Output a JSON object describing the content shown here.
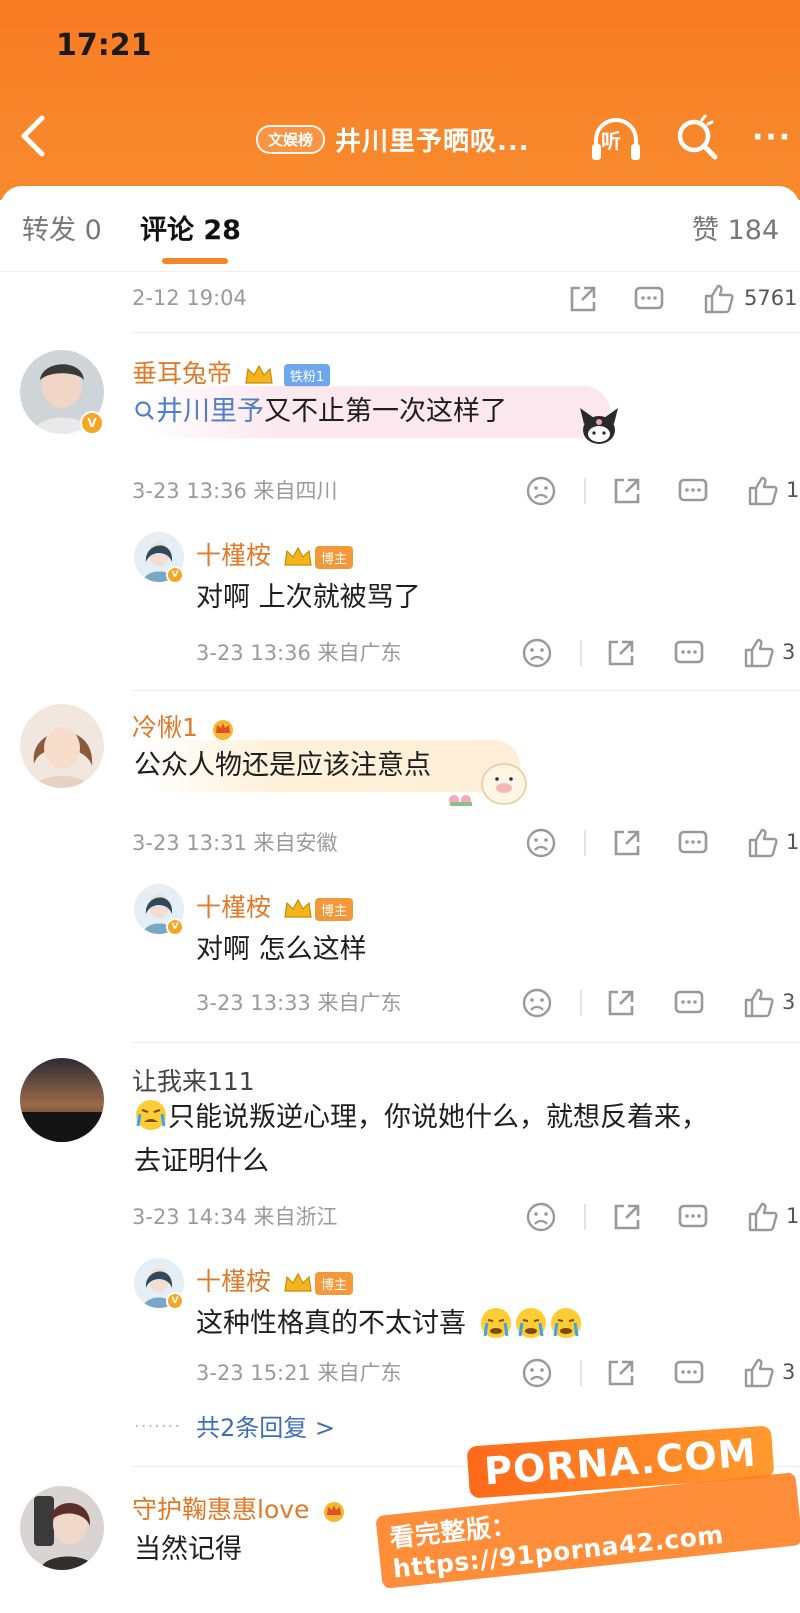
{
  "status_bar": {
    "time": "17:21"
  },
  "header": {
    "tag": "文娱榜",
    "title": "井川里予晒吸...",
    "listen_label": "听",
    "more_label": "···"
  },
  "tabs": [
    {
      "label": "转发 0"
    },
    {
      "label": "评论 28"
    },
    {
      "label": "赞 184"
    }
  ],
  "post_meta": {
    "time": "2-12 19:04",
    "likes": "5761"
  },
  "comments": [
    {
      "username": "垂耳兔帝",
      "fan_badge": "铁粉1",
      "topic": "井川里予",
      "text": "又不止第一次这样了",
      "time": "3-23 13:36 来自四川",
      "likes": "1",
      "reply": {
        "username": "十槿桉",
        "badge": "博主",
        "text": "对啊 上次就被骂了",
        "time": "3-23 13:36 来自广东",
        "likes": "3"
      }
    },
    {
      "username": "冷愀1",
      "text": "公众人物还是应该注意点",
      "time": "3-23 13:31 来自安徽",
      "likes": "1",
      "reply": {
        "username": "十槿桉",
        "badge": "博主",
        "text": "对啊 怎么这样",
        "time": "3-23 13:33 来自广东",
        "likes": "3"
      }
    },
    {
      "username": "让我来111",
      "text_line1": "只能说叛逆心理，你说她什么，就想反着来，",
      "text_line2": "去证明什么",
      "time": "3-23 14:34 来自浙江",
      "likes": "1",
      "reply": {
        "username": "十槿桉",
        "badge": "博主",
        "text": "这种性格真的不太讨喜",
        "time": "3-23 15:21 来自广东",
        "likes": "3"
      },
      "more_replies": "共2条回复 >"
    },
    {
      "username": "守护鞠惠惠love",
      "text": "当然记得"
    }
  ],
  "watermark": {
    "logo": "PORNA.COM",
    "url": "看完整版：https://91porna42.com"
  },
  "colors": {
    "header_orange": "#f97a22",
    "username_orange": "#e07a2a",
    "link_blue": "#4f7fc9"
  }
}
